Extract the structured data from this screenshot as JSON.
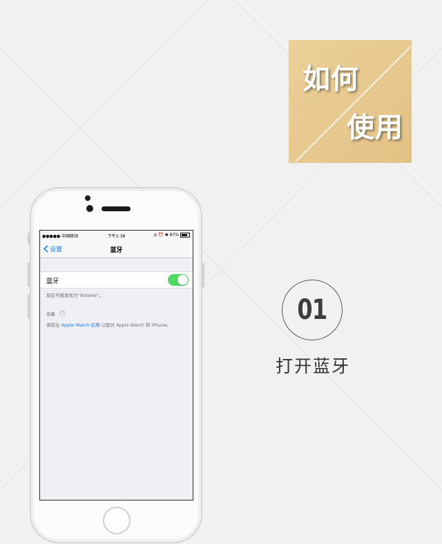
{
  "badge": {
    "line1": "如何",
    "line2": "使用"
  },
  "phone": {
    "status_bar": {
      "carrier": "●●●●● 中国移动",
      "time": "下午2:38",
      "battery": "87%"
    },
    "nav": {
      "back_label": "设置",
      "title": "蓝牙"
    },
    "bluetooth": {
      "label": "蓝牙",
      "enabled": true
    },
    "discoverable_text": "现在可被发现为“Nidalee”。",
    "devices_label": "设备",
    "hint": {
      "prefix": "请前往 ",
      "link": "Apple Watch 应用",
      "suffix": " 以配对 Apple Watch 和 iPhone。"
    }
  },
  "step": {
    "number": "01",
    "label": "打开蓝牙"
  }
}
